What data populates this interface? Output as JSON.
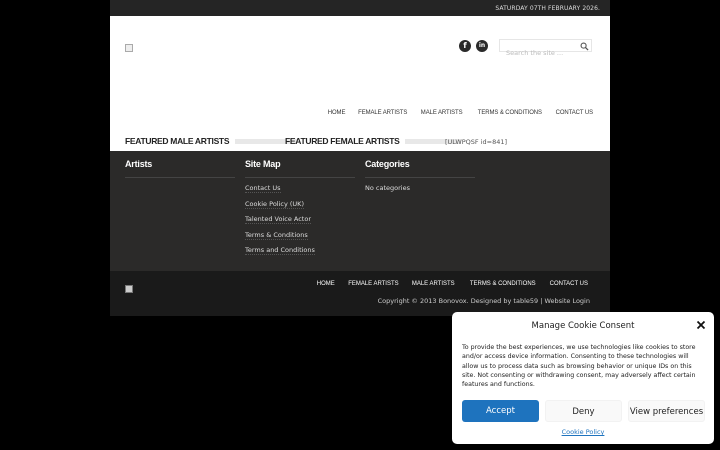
{
  "topbar": {
    "date": "SATURDAY 07TH FEBRUARY 2026."
  },
  "header": {
    "social": {
      "facebook": "f",
      "linkedin": "in"
    },
    "search": {
      "placeholder": "Search the site ..."
    },
    "nav": [
      "HOME",
      "FEMALE ARTISTS",
      "MALE ARTISTS",
      "TERMS & CONDITIONS",
      "CONTACT US"
    ]
  },
  "featured": {
    "male_title": "FEATURED MALE ARTISTS",
    "female_title": "FEATURED FEMALE ARTISTS",
    "shortcode": "[ULWPQSF id=841]"
  },
  "footer": {
    "artists": {
      "title": "Artists"
    },
    "sitemap": {
      "title": "Site Map",
      "links": [
        "Contact Us",
        "Cookie Policy (UK)",
        "Talented Voice Actor",
        "Terms & Conditions",
        "Terms and Conditions"
      ]
    },
    "categories": {
      "title": "Categories",
      "empty": "No categories"
    }
  },
  "bottom": {
    "nav": [
      "HOME",
      "FEMALE ARTISTS",
      "MALE ARTISTS",
      "TERMS & CONDITIONS",
      "CONTACT US"
    ],
    "copyright": "Copyright © 2013 Bonovox. Designed by table59 | Website Login"
  },
  "cookie": {
    "title": "Manage Cookie Consent",
    "text": "To provide the best experiences, we use technologies like cookies to store and/or access device information. Consenting to these technologies will allow us to process data such as browsing behavior or unique IDs on this site. Not consenting or withdrawing consent, may adversely affect certain features and functions.",
    "accept": "Accept",
    "deny": "Deny",
    "preferences": "View preferences",
    "policy": "Cookie Policy",
    "accent": "#1e73be"
  }
}
